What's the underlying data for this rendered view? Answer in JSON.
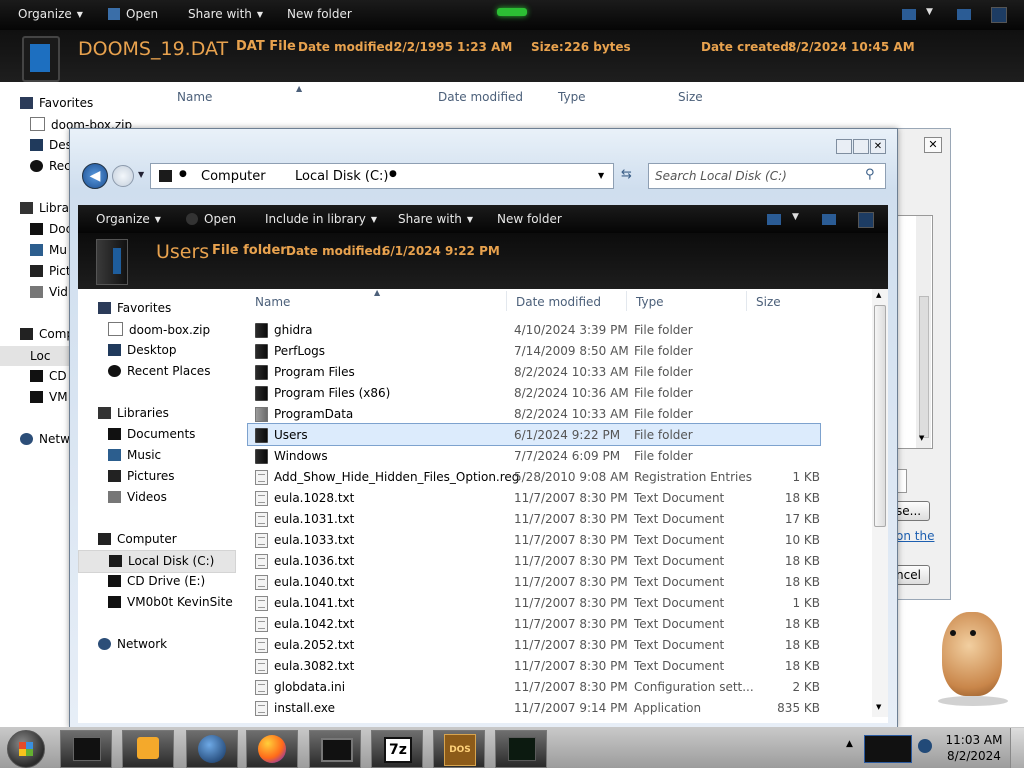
{
  "bg_window": {
    "toolbar": {
      "organize": "Organize",
      "open": "Open",
      "share_with": "Share with",
      "new_folder": "New folder"
    },
    "details": {
      "filename": "DOOMS_19.DAT",
      "type": "DAT File",
      "date_modified_label": "Date modified:",
      "date_modified": "2/2/1995 1:23 AM",
      "size_label": "Size:",
      "size": "226 bytes",
      "date_created_label": "Date created:",
      "date_created": "8/2/2024 10:45 AM"
    },
    "columns": {
      "name": "Name",
      "date_modified": "Date modified",
      "type": "Type",
      "size": "Size"
    },
    "nav": {
      "favorites": "Favorites",
      "doom_box": "doom-box.zip",
      "desktop": "Des",
      "recent": "Rec",
      "libraries": "Libra",
      "documents": "Doc",
      "music": "Mu",
      "pictures": "Pict",
      "videos": "Vid",
      "computer": "Comp",
      "local_disk": "Loc",
      "cd_drive": "CD",
      "vm": "VM",
      "network": "Netw"
    },
    "dialog_fragments": {
      "browse": "se...",
      "link": "on the",
      "cancel": "ncel"
    }
  },
  "front_window": {
    "address": {
      "computer": "Computer",
      "local_disk": "Local Disk (C:)"
    },
    "search_placeholder": "Search Local Disk (C:)",
    "toolbar": {
      "organize": "Organize",
      "open": "Open",
      "include_in_library": "Include in library",
      "share_with": "Share with",
      "new_folder": "New folder"
    },
    "details": {
      "name": "Users",
      "type": "File folder",
      "date_modified_label": "Date modified:",
      "date_modified": "6/1/2024 9:22 PM"
    },
    "nav": {
      "favorites": "Favorites",
      "doom_box": "doom-box.zip",
      "desktop": "Desktop",
      "recent_places": "Recent Places",
      "libraries": "Libraries",
      "documents": "Documents",
      "music": "Music",
      "pictures": "Pictures",
      "videos": "Videos",
      "computer": "Computer",
      "local_disk": "Local Disk (C:)",
      "cd_drive": "CD Drive (E:)",
      "vm": "VM0b0t KevinSite",
      "network": "Network"
    },
    "columns": {
      "name": "Name",
      "date_modified": "Date modified",
      "type": "Type",
      "size": "Size"
    },
    "files": [
      {
        "name": "ghidra",
        "date": "4/10/2024 3:39 PM",
        "type": "File folder",
        "size": "",
        "icon": "folder"
      },
      {
        "name": "PerfLogs",
        "date": "7/14/2009 8:50 AM",
        "type": "File folder",
        "size": "",
        "icon": "folder"
      },
      {
        "name": "Program Files",
        "date": "8/2/2024 10:33 AM",
        "type": "File folder",
        "size": "",
        "icon": "folder"
      },
      {
        "name": "Program Files (x86)",
        "date": "8/2/2024 10:36 AM",
        "type": "File folder",
        "size": "",
        "icon": "folder"
      },
      {
        "name": "ProgramData",
        "date": "8/2/2024 10:33 AM",
        "type": "File folder",
        "size": "",
        "icon": "folder-hidden"
      },
      {
        "name": "Users",
        "date": "6/1/2024 9:22 PM",
        "type": "File folder",
        "size": "",
        "icon": "folder",
        "selected": true
      },
      {
        "name": "Windows",
        "date": "7/7/2024 6:09 PM",
        "type": "File folder",
        "size": "",
        "icon": "folder"
      },
      {
        "name": "Add_Show_Hide_Hidden_Files_Option.reg",
        "date": "5/28/2010 9:08 AM",
        "type": "Registration Entries",
        "size": "1 KB",
        "icon": "reg"
      },
      {
        "name": "eula.1028.txt",
        "date": "11/7/2007 8:30 PM",
        "type": "Text Document",
        "size": "18 KB",
        "icon": "text"
      },
      {
        "name": "eula.1031.txt",
        "date": "11/7/2007 8:30 PM",
        "type": "Text Document",
        "size": "17 KB",
        "icon": "text"
      },
      {
        "name": "eula.1033.txt",
        "date": "11/7/2007 8:30 PM",
        "type": "Text Document",
        "size": "10 KB",
        "icon": "text"
      },
      {
        "name": "eula.1036.txt",
        "date": "11/7/2007 8:30 PM",
        "type": "Text Document",
        "size": "18 KB",
        "icon": "text"
      },
      {
        "name": "eula.1040.txt",
        "date": "11/7/2007 8:30 PM",
        "type": "Text Document",
        "size": "18 KB",
        "icon": "text"
      },
      {
        "name": "eula.1041.txt",
        "date": "11/7/2007 8:30 PM",
        "type": "Text Document",
        "size": "1 KB",
        "icon": "text"
      },
      {
        "name": "eula.1042.txt",
        "date": "11/7/2007 8:30 PM",
        "type": "Text Document",
        "size": "18 KB",
        "icon": "text"
      },
      {
        "name": "eula.2052.txt",
        "date": "11/7/2007 8:30 PM",
        "type": "Text Document",
        "size": "18 KB",
        "icon": "text"
      },
      {
        "name": "eula.3082.txt",
        "date": "11/7/2007 8:30 PM",
        "type": "Text Document",
        "size": "18 KB",
        "icon": "text"
      },
      {
        "name": "globdata.ini",
        "date": "11/7/2007 8:30 PM",
        "type": "Configuration sett...",
        "size": "2 KB",
        "icon": "text"
      },
      {
        "name": "install.exe",
        "date": "11/7/2007 9:14 PM",
        "type": "Application",
        "size": "835 KB",
        "icon": "exe"
      }
    ]
  },
  "taskbar": {
    "time": "11:03 AM",
    "date": "8/2/2024",
    "apps": [
      "explorer",
      "media-player",
      "network-globe",
      "firefox",
      "monitor",
      "7-zip",
      "dosbox",
      "task-manager"
    ],
    "app_labels": {
      "seven_zip": "7z",
      "dosbox": "DOS"
    }
  },
  "colors": {
    "detail_accent": "#e8a24e",
    "selection": "#dcebfc",
    "selection_border": "#7da2ce"
  }
}
